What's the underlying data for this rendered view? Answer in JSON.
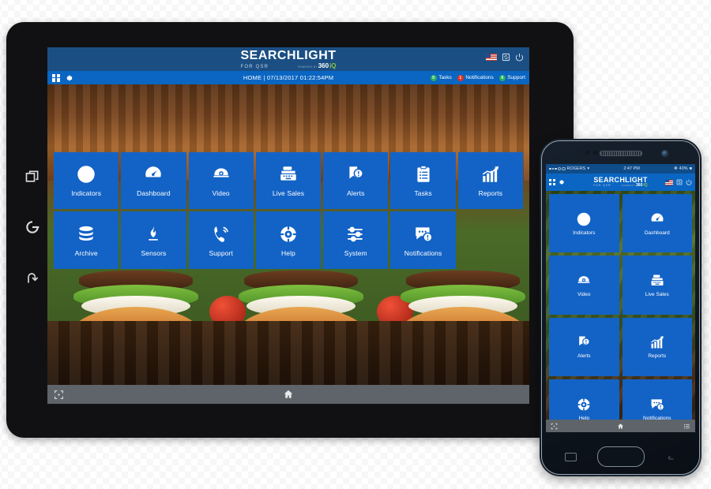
{
  "brand": {
    "name": "SEARCHLIGHT",
    "tagline": "FOR QSR",
    "powered_by": "POWERED BY",
    "powered_num": "360",
    "powered_iq": "iQ",
    "accent_blue": "#1363c6",
    "nav_blue": "#0a66c2",
    "logo_navy": "#1b4f84",
    "iq_green": "#8dc63f"
  },
  "tablet": {
    "nav": {
      "breadcrumb": "HOME | 07/13/2017 01:22:54PM",
      "status_items": [
        {
          "count": "0",
          "label": "Tasks",
          "color": "green"
        },
        {
          "count": "1",
          "label": "Notifications",
          "color": "red"
        },
        {
          "count": "0",
          "label": "Support",
          "color": "green"
        }
      ]
    },
    "tiles": [
      {
        "label": "Indicators",
        "icon": "exclamation-circle-icon"
      },
      {
        "label": "Dashboard",
        "icon": "gauge-icon"
      },
      {
        "label": "Video",
        "icon": "dome-camera-icon"
      },
      {
        "label": "Live Sales",
        "icon": "cash-register-icon"
      },
      {
        "label": "Alerts",
        "icon": "alert-ribbon-icon"
      },
      {
        "label": "Tasks",
        "icon": "clipboard-icon"
      },
      {
        "label": "Reports",
        "icon": "bar-chart-icon"
      },
      {
        "label": "Archive",
        "icon": "database-icon"
      },
      {
        "label": "Sensors",
        "icon": "flame-icon"
      },
      {
        "label": "Support",
        "icon": "phone-signal-icon"
      },
      {
        "label": "Help",
        "icon": "life-ring-icon"
      },
      {
        "label": "System",
        "icon": "sliders-icon"
      },
      {
        "label": "Notifications",
        "icon": "speech-bubble-alert-icon"
      }
    ],
    "bottom_bar": {
      "left": "fullscreen-icon",
      "center": "home-icon"
    },
    "bezel": {
      "recent": "recent-apps-icon",
      "home": "home-power-icon",
      "back": "back-arrow-icon"
    }
  },
  "phone": {
    "status": {
      "carrier": "ROGERS",
      "time": "2:47 PM",
      "battery": "40%"
    },
    "tiles": [
      {
        "label": "Indicators",
        "icon": "exclamation-circle-icon"
      },
      {
        "label": "Dashboard",
        "icon": "gauge-icon"
      },
      {
        "label": "Video",
        "icon": "dome-camera-icon"
      },
      {
        "label": "Live Sales",
        "icon": "cash-register-icon"
      },
      {
        "label": "Alerts",
        "icon": "alert-ribbon-icon"
      },
      {
        "label": "Reports",
        "icon": "bar-chart-icon"
      },
      {
        "label": "Help",
        "icon": "life-ring-icon"
      },
      {
        "label": "Notifications",
        "icon": "speech-bubble-alert-icon"
      }
    ],
    "bottom_bar": {
      "left": "fullscreen-icon",
      "center": "home-icon",
      "right": "menu-list-icon"
    }
  }
}
